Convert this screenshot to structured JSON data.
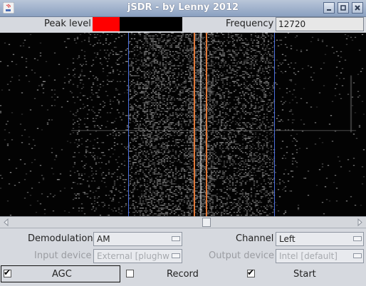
{
  "window": {
    "title": "jSDR - by Lenny 2012",
    "buttons": [
      "minimize",
      "maximize",
      "close"
    ]
  },
  "peak": {
    "label": "Peak level",
    "level_fraction": 0.3,
    "color": "#ff0000"
  },
  "frequency": {
    "label": "Frequency",
    "value": "12720"
  },
  "waterfall": {
    "markers": [
      {
        "color": "#4b6fe0",
        "role": "band-edge"
      },
      {
        "color": "#e07838",
        "role": "tuning"
      },
      {
        "color": "#e07838",
        "role": "tuning"
      },
      {
        "color": "#4b6fe0",
        "role": "band-edge"
      }
    ],
    "scroll_position_fraction": 0.57
  },
  "controls": {
    "demodulation": {
      "label": "Demodulation",
      "value": "AM"
    },
    "channel": {
      "label": "Channel",
      "value": "Left"
    },
    "input_device": {
      "label": "Input device",
      "value": "External [plughw"
    },
    "output_device": {
      "label": "Output device",
      "value": "Intel [default]"
    },
    "agc": {
      "label": "AGC",
      "checked": true
    },
    "record": {
      "label": "Record",
      "checked": false
    },
    "start": {
      "label": "Start",
      "checked": true
    }
  }
}
